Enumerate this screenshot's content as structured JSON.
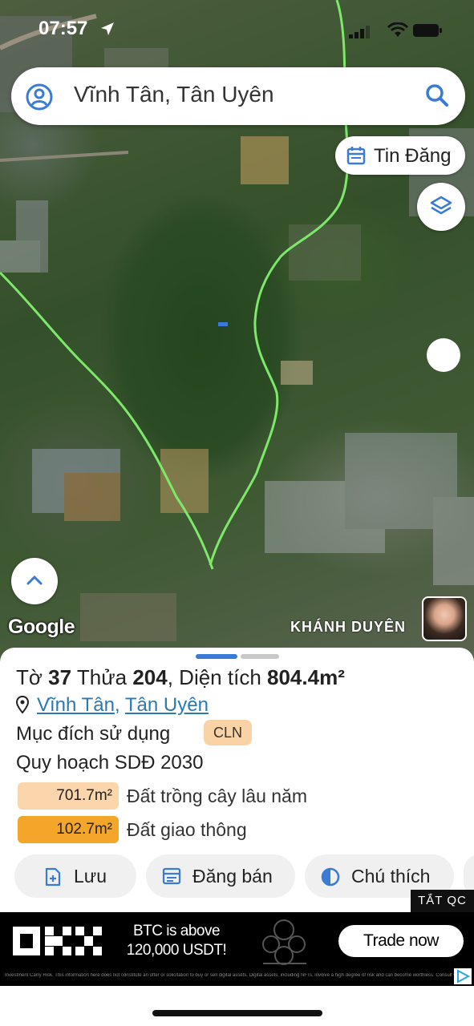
{
  "status": {
    "time": "07:57"
  },
  "search": {
    "query": "Vĩnh Tân, Tân Uyên"
  },
  "map": {
    "tin_dang_label": "Tin Đăng",
    "google_label": "Google",
    "watermark": "KHÁNH DUYÊN",
    "boundary_color": "#7de86a"
  },
  "parcel": {
    "title_prefix": "Tờ",
    "sheet_no": "37",
    "plot_label": "Thửa",
    "plot_no": "204",
    "area_label": "Diện tích",
    "area_value": "804.4m²",
    "ward": "Vĩnh Tân",
    "separator": ",",
    "district": "Tân Uyên",
    "purpose_label": "Mục đích sử dụng",
    "purpose_code": "CLN",
    "plan_label": "Quy hoạch SDĐ 2030",
    "uses": [
      {
        "area": "701.7m²",
        "label": "Đất trồng cây lâu năm",
        "color": "#fbd6ac"
      },
      {
        "area": "102.7m²",
        "label": "Đất giao thông",
        "color": "#f3a62a"
      }
    ]
  },
  "actions": {
    "save": "Lưu",
    "post_sale": "Đăng bán",
    "legend": "Chú thích"
  },
  "ad": {
    "close_label": "TẮT QC",
    "headline": "BTC is above 120,000 USDT!",
    "cta": "Trade now",
    "fine_print": "Investment Carry Risk. This information here does not constitute an offer or solicitation to buy or sell digital assets. Digital assets, including NFTs, involve a high degree of risk and can become worthless. Consult with legal / tax / investment professionals before acting."
  }
}
